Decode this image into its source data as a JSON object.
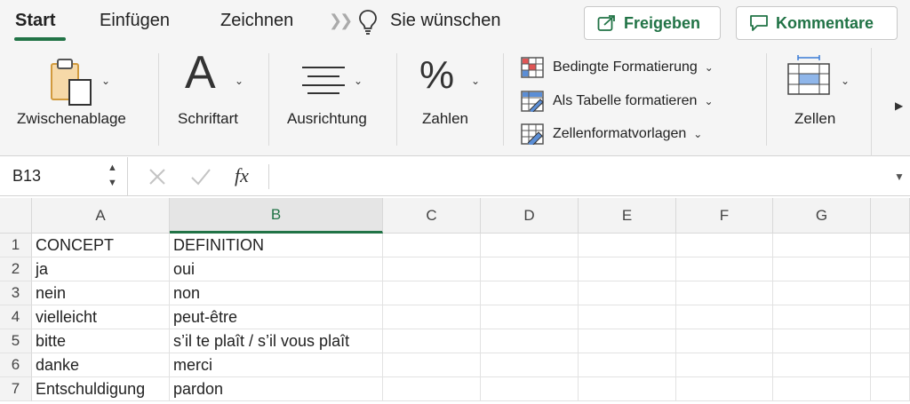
{
  "tabs": {
    "items": [
      {
        "label": "Start",
        "active": true
      },
      {
        "label": "Einfügen",
        "active": false
      },
      {
        "label": "Zeichnen",
        "active": false
      }
    ],
    "tell_me": "Sie wünschen",
    "share_label": "Freigeben",
    "comments_label": "Kommentare"
  },
  "ribbon": {
    "clipboard_label": "Zwischenablage",
    "font_label": "Schriftart",
    "alignment_label": "Ausrichtung",
    "number_label": "Zahlen",
    "number_glyph": "%",
    "font_glyph": "A",
    "styles": {
      "conditional": "Bedingte Formatierung",
      "as_table": "Als Tabelle formatieren",
      "cell_styles": "Zellenformatvorlagen"
    },
    "cells_label": "Zellen"
  },
  "formula_bar": {
    "name_box": "B13",
    "fx": "fx",
    "content": ""
  },
  "grid": {
    "columns": [
      "A",
      "B",
      "C",
      "D",
      "E",
      "F",
      "G"
    ],
    "selected_column": "B",
    "rows": [
      {
        "num": "1",
        "a": "CONCEPT",
        "b": "DEFINITION"
      },
      {
        "num": "2",
        "a": "ja",
        "b": "oui"
      },
      {
        "num": "3",
        "a": "nein",
        "b": "non"
      },
      {
        "num": "4",
        "a": "vielleicht",
        "b": "peut-être"
      },
      {
        "num": "5",
        "a": "bitte",
        "b": "s’il te plaît / s’il vous plaît"
      },
      {
        "num": "6",
        "a": "danke",
        "b": "merci"
      },
      {
        "num": "7",
        "a": "Entschuldigung",
        "b": "pardon"
      }
    ]
  },
  "colors": {
    "accent": "#217346",
    "ribbon_bg": "#f5f5f5",
    "header_bg": "#f3f3f3"
  },
  "icons": {
    "share": "share-arrow-icon",
    "comments": "speech-bubble-icon",
    "tell_me": "lightbulb-icon",
    "clipboard": "clipboard-paste-icon",
    "alignment": "align-lines-icon",
    "conditional": "conditional-format-icon",
    "as_table": "table-format-icon",
    "cell_styles": "cell-styles-icon",
    "cells": "cells-grid-icon"
  }
}
